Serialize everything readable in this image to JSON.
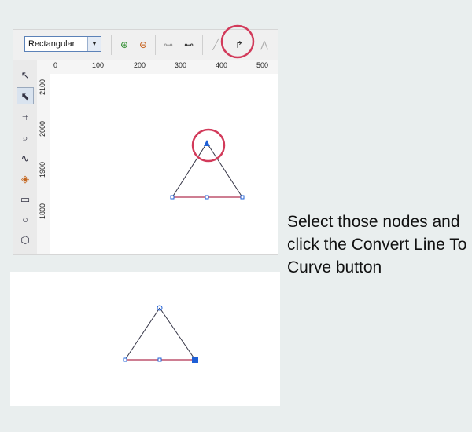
{
  "property_bar": {
    "mode_select_value": "Rectangular"
  },
  "ruler": {
    "h_labels": [
      "0",
      "100",
      "200",
      "300",
      "400",
      "500"
    ],
    "v_labels": [
      "2100",
      "2000",
      "1900",
      "1800"
    ]
  },
  "caption": {
    "text": "Select those nodes and click the Convert Line To Curve button"
  },
  "colors": {
    "highlight_circle": "#d23a5a",
    "node_fill": "#1e5fd6"
  }
}
